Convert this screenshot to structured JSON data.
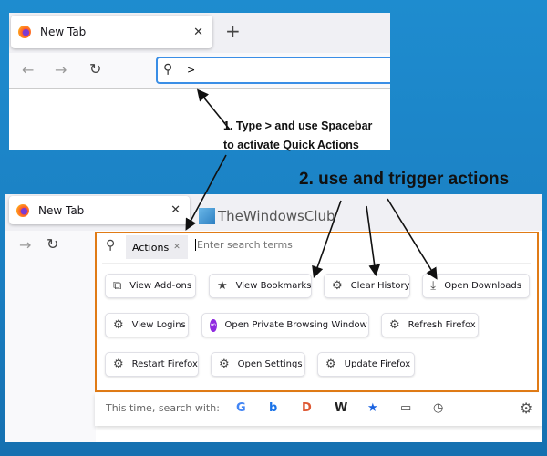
{
  "top_browser": {
    "tab_title": "New Tab",
    "close": "✕",
    "new_tab": "+",
    "back": "←",
    "forward": "→",
    "reload": "↻",
    "url_value": ">"
  },
  "note1": {
    "line1": "1. Type > and use Spacebar",
    "line2": "to activate Quick Actions"
  },
  "note2": "2. use and trigger actions",
  "bottom_browser": {
    "tab_title": "New Tab",
    "close": "✕",
    "forward": "→",
    "reload": "↻",
    "watermark": "TheWindowsClub",
    "search_chip": "Actions",
    "chip_close": "✕",
    "search_placeholder": "Enter search terms",
    "actions": [
      {
        "label": "View Add-ons",
        "icon": "puzzle-icon"
      },
      {
        "label": "View Bookmarks",
        "icon": "star-icon"
      },
      {
        "label": "Clear History",
        "icon": "gear-icon"
      },
      {
        "label": "Open Downloads",
        "icon": "download-icon"
      },
      {
        "label": "View Logins",
        "icon": "gear-icon"
      },
      {
        "label": "Open Private Browsing Window",
        "icon": "private-mask-icon"
      },
      {
        "label": "Refresh Firefox",
        "icon": "gear-icon"
      },
      {
        "label": "Restart Firefox",
        "icon": "gear-icon"
      },
      {
        "label": "Open Settings",
        "icon": "gear-icon"
      },
      {
        "label": "Update Firefox",
        "icon": "gear-icon"
      }
    ],
    "search_with": "This time, search with:",
    "engines": [
      "G",
      "b",
      "D",
      "W",
      "★",
      "▭",
      "◷"
    ],
    "settings": "⚙"
  },
  "colors": {
    "background": "#1a85c8",
    "highlight_border": "#e07b16",
    "focus": "#3a8ee6",
    "private": "#8f2ae0"
  }
}
